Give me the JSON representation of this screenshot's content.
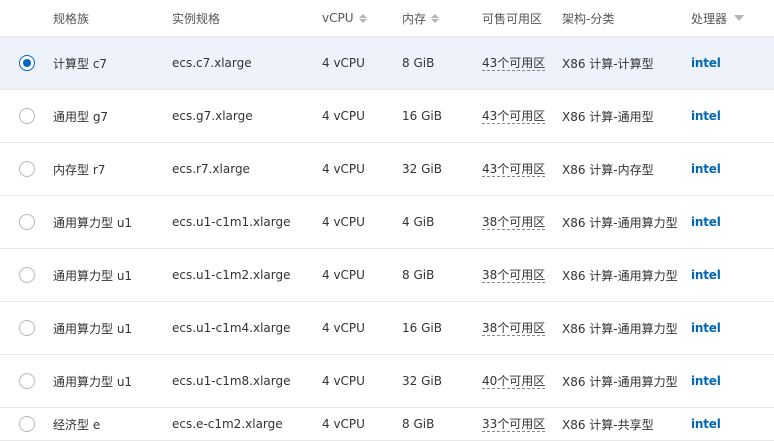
{
  "header": {
    "family": "规格族",
    "spec": "实例规格",
    "vcpu": "vCPU",
    "memory": "内存",
    "zones": "可售可用区",
    "arch": "架构-分类",
    "processor": "处理器"
  },
  "rows": [
    {
      "family": "计算型 c7",
      "spec": "ecs.c7.xlarge",
      "vcpu": "4 vCPU",
      "memory": "8 GiB",
      "zones": "43个可用区",
      "arch": "X86 计算-计算型",
      "processor": "intel"
    },
    {
      "family": "通用型 g7",
      "spec": "ecs.g7.xlarge",
      "vcpu": "4 vCPU",
      "memory": "16 GiB",
      "zones": "43个可用区",
      "arch": "X86 计算-通用型",
      "processor": "intel"
    },
    {
      "family": "内存型 r7",
      "spec": "ecs.r7.xlarge",
      "vcpu": "4 vCPU",
      "memory": "32 GiB",
      "zones": "43个可用区",
      "arch": "X86 计算-内存型",
      "processor": "intel"
    },
    {
      "family": "通用算力型 u1",
      "spec": "ecs.u1-c1m1.xlarge",
      "vcpu": "4 vCPU",
      "memory": "4 GiB",
      "zones": "38个可用区",
      "arch": "X86 计算-通用算力型",
      "processor": "intel"
    },
    {
      "family": "通用算力型 u1",
      "spec": "ecs.u1-c1m2.xlarge",
      "vcpu": "4 vCPU",
      "memory": "8 GiB",
      "zones": "38个可用区",
      "arch": "X86 计算-通用算力型",
      "processor": "intel"
    },
    {
      "family": "通用算力型 u1",
      "spec": "ecs.u1-c1m4.xlarge",
      "vcpu": "4 vCPU",
      "memory": "16 GiB",
      "zones": "38个可用区",
      "arch": "X86 计算-通用算力型",
      "processor": "intel"
    },
    {
      "family": "通用算力型 u1",
      "spec": "ecs.u1-c1m8.xlarge",
      "vcpu": "4 vCPU",
      "memory": "32 GiB",
      "zones": "40个可用区",
      "arch": "X86 计算-通用算力型",
      "processor": "intel"
    },
    {
      "family": "经济型 e",
      "spec": "ecs.e-c1m2.xlarge",
      "vcpu": "4 vCPU",
      "memory": "8 GiB",
      "zones": "33个可用区",
      "arch": "X86 计算-共享型",
      "processor": "intel"
    }
  ],
  "selected_row": 0,
  "colors": {
    "accent": "#0064c8",
    "selected_bg": "#eef3fb",
    "intel": "#0068b5"
  }
}
